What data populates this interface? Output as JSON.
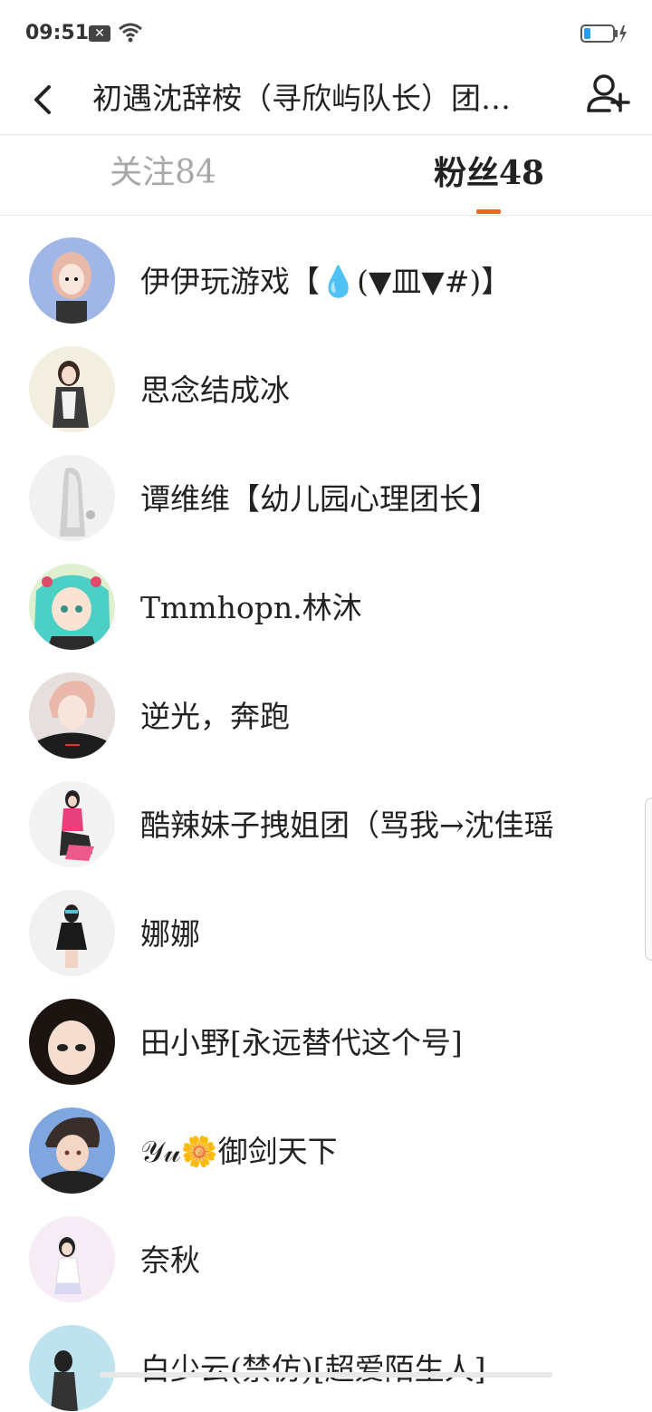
{
  "status": {
    "time": "09:51"
  },
  "header": {
    "title": "初遇沈辞桉（寻欣屿队长）团…"
  },
  "tabs": {
    "following": "关注84",
    "fans": "粉丝48"
  },
  "fans": [
    {
      "name": "伊伊玩游戏【💧(▼皿▼#)】"
    },
    {
      "name": "思念结成冰"
    },
    {
      "name": "谭维维【幼儿园心理团长】"
    },
    {
      "name": "Tmmhopn.林沐"
    },
    {
      "name": "逆光，奔跑"
    },
    {
      "name": "酷辣妹子拽姐团（骂我→沈佳瑶"
    },
    {
      "name": "娜娜"
    },
    {
      "name": "田小野[永远替代这个号]"
    },
    {
      "name": "𝒴𝓊🌼御剑天下"
    },
    {
      "name": "奈秋"
    },
    {
      "name": "白少云(禁仿)[超爱陌生人]"
    }
  ]
}
